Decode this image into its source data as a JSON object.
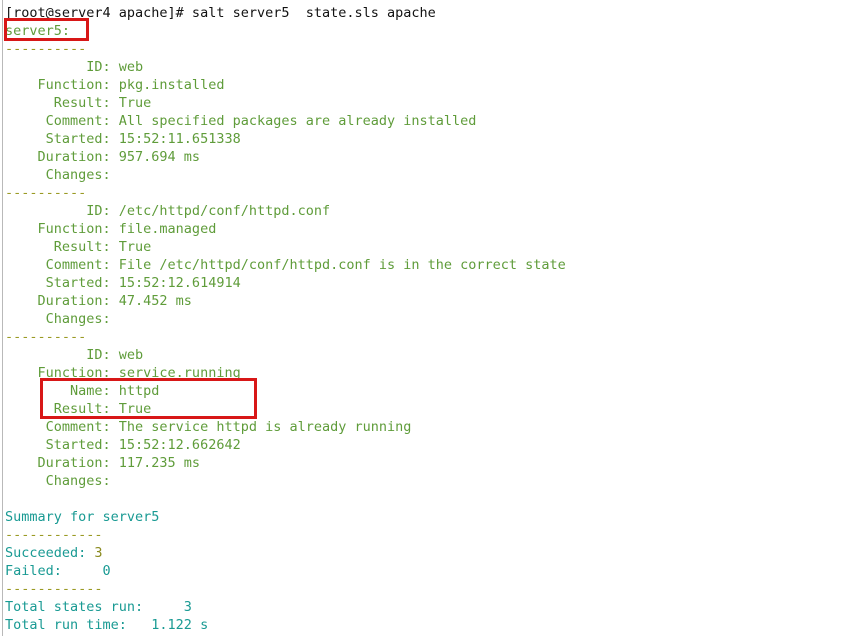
{
  "terminal": {
    "background": "#ffffff",
    "colors": {
      "prompt": "#121212",
      "state_text": "#5f9c3a",
      "separator": "#9a9a24",
      "summary": "#199a93",
      "succeeded_count": "#8a8a1f",
      "highlight_box": "#d81717"
    },
    "prompt_line": "[root@server4 apache]# salt server5  state.sls apache",
    "minion_header": "server5:",
    "separator": "----------",
    "summary_separator": "------------",
    "blocks": [
      {
        "id_line": "          ID: web",
        "function_line": "    Function: pkg.installed",
        "result_line": "      Result: True",
        "comment_line": "     Comment: All specified packages are already installed",
        "started_line": "     Started: 15:52:11.651338",
        "duration_line": "    Duration: 957.694 ms",
        "changes_line": "     Changes:"
      },
      {
        "id_line": "          ID: /etc/httpd/conf/httpd.conf",
        "function_line": "    Function: file.managed",
        "result_line": "      Result: True",
        "comment_line": "     Comment: File /etc/httpd/conf/httpd.conf is in the correct state",
        "started_line": "     Started: 15:52:12.614914",
        "duration_line": "    Duration: 47.452 ms",
        "changes_line": "     Changes:"
      },
      {
        "id_line": "          ID: web",
        "function_line": "    Function: service.running",
        "name_line": "        Name: httpd",
        "result_line": "      Result: True",
        "comment_line": "     Comment: The service httpd is already running",
        "started_line": "     Started: 15:52:12.662642",
        "duration_line": "    Duration: 117.235 ms",
        "changes_line": "     Changes:"
      }
    ],
    "summary": {
      "title": "Summary for server5",
      "succeeded_label": "Succeeded: ",
      "succeeded_value": "3",
      "failed_line": "Failed:     0",
      "total_states_line": "Total states run:     3",
      "total_time_line": "Total run time:   1.122 s"
    },
    "annotations": [
      {
        "name": "minion-name-highlight",
        "target": "server5:"
      },
      {
        "name": "name-result-highlight",
        "target": "Name: httpd / Result: True"
      }
    ]
  }
}
